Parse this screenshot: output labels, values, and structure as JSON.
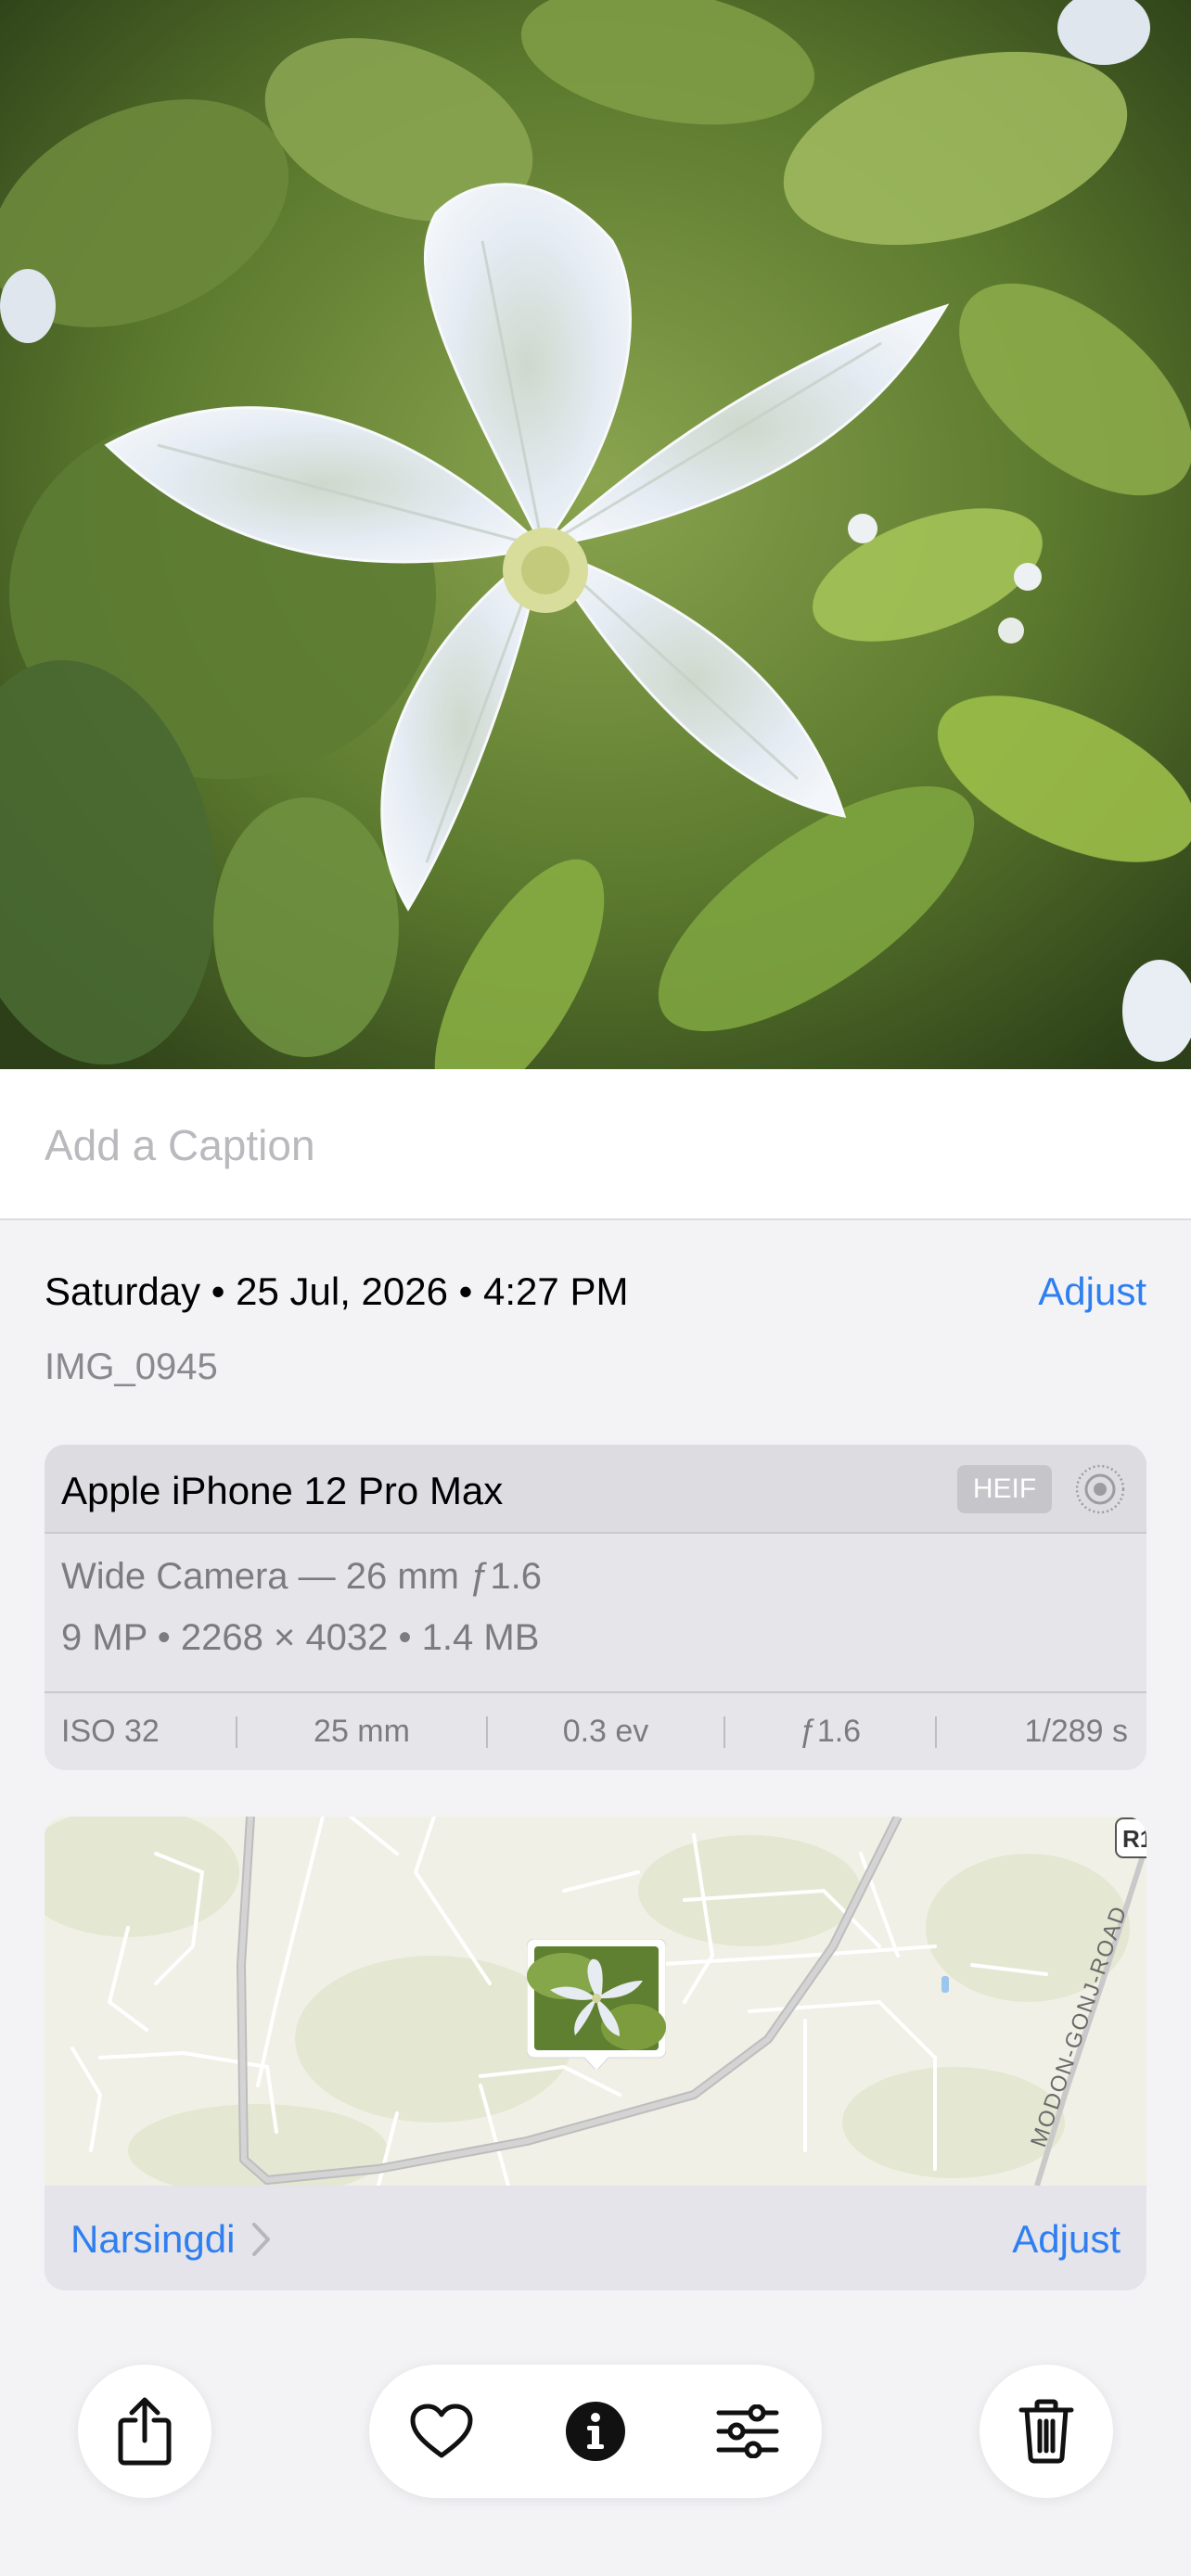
{
  "photo": {
    "subject": "white-flower-photo"
  },
  "caption": {
    "placeholder": "Add a Caption"
  },
  "info": {
    "datetime": "Saturday • 25 Jul, 2026 • 4:27 PM",
    "adjust_label": "Adjust",
    "filename": "IMG_0945"
  },
  "device": {
    "name": "Apple iPhone 12 Pro Max",
    "format_badge": "HEIF",
    "lens": "Wide Camera — 26 mm ƒ1.6",
    "specs": "9 MP • 2268 × 4032 • 1.4 MB",
    "exif": [
      "ISO 32",
      "25 mm",
      "0.3 ev",
      "ƒ1.6",
      "1/289 s"
    ]
  },
  "map": {
    "road_label": "MODON-GONJ-ROAD",
    "route_badge": "R1",
    "place": "Narsingdi",
    "adjust_label": "Adjust"
  },
  "toolbar": {
    "icons": [
      "share-icon",
      "heart-icon",
      "info-icon",
      "sliders-icon",
      "trash-icon"
    ]
  },
  "colors": {
    "accent": "#2f7ff0",
    "background": "#f3f3f6",
    "card": "#e6e6ea",
    "secondary_text": "#7c7c80"
  }
}
